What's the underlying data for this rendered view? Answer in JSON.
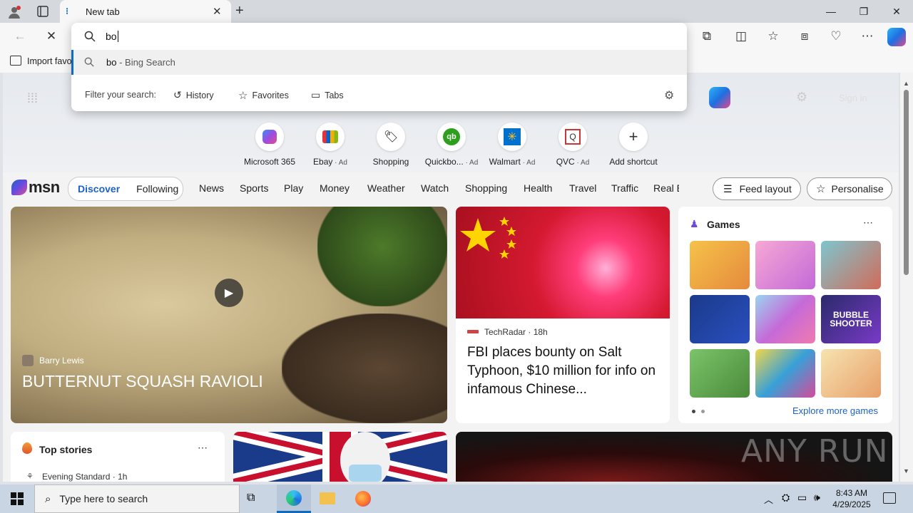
{
  "browser": {
    "tab_title": "New tab",
    "address_value": "bo",
    "favbar_item": "Import favo"
  },
  "dropdown": {
    "suggestion_query": "bo",
    "suggestion_suffix": " - Bing Search",
    "filter_label": "Filter your search:",
    "filters": [
      "History",
      "Favorites",
      "Tabs"
    ]
  },
  "page_header": {
    "sign_in": "Sign in"
  },
  "shortcuts": [
    {
      "label": "Microsoft 365",
      "ad": ""
    },
    {
      "label": "Ebay",
      "ad": " · Ad"
    },
    {
      "label": "Shopping",
      "ad": ""
    },
    {
      "label": "Quickbo...",
      "ad": " · Ad"
    },
    {
      "label": "Walmart",
      "ad": " · Ad"
    },
    {
      "label": "QVC",
      "ad": " · Ad"
    },
    {
      "label": "Add shortcut",
      "ad": ""
    }
  ],
  "msn": {
    "logo": "msn",
    "discover": "Discover",
    "following": "Following",
    "nav": [
      "News",
      "Sports",
      "Play",
      "Money",
      "Weather",
      "Watch",
      "Shopping",
      "Health",
      "Travel",
      "Traffic",
      "Real E"
    ],
    "feed_layout": "Feed layout",
    "personalise": "Personalise"
  },
  "hero": {
    "author": "Barry Lewis",
    "title": "BUTTERNUT SQUASH RAVIOLI"
  },
  "news": {
    "source": "TechRadar",
    "age": "18h",
    "headline": "FBI places bounty on Salt Typhoon, $10 million for info on infamous Chinese..."
  },
  "games": {
    "title": "Games",
    "explore": "Explore more games",
    "bubble_text": "BUBBLE SHOOTER"
  },
  "top_stories": {
    "title": "Top stories",
    "source": "Evening Standard",
    "age": "1h"
  },
  "watermark": "ANY RUN",
  "taskbar": {
    "search_placeholder": "Type here to search",
    "time": "8:43 AM",
    "date": "4/29/2025"
  },
  "colors": {
    "accent": "#0f6cbd",
    "msn_blue": "#1c62c6",
    "hero_bg": "#b7a47f"
  }
}
